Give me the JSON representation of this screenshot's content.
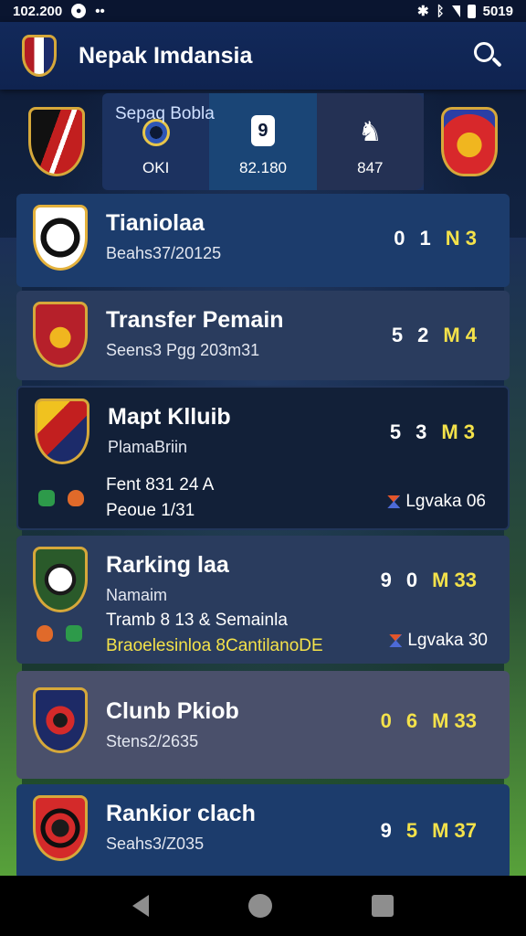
{
  "status_bar": {
    "time": "102.200",
    "clock": "5019"
  },
  "app_bar": {
    "title": "Nepak Imdansia",
    "search_icon": "search-icon"
  },
  "featured": {
    "label": "Sepaq Bobla",
    "stats": [
      {
        "icon": "ball-icon",
        "value": "OKI"
      },
      {
        "icon": "phone-icon",
        "glyph": "9",
        "value": "82.180"
      },
      {
        "icon": "chess-knight-icon",
        "glyph": "♞",
        "value": "847"
      }
    ]
  },
  "cards": [
    {
      "title": "Tianiolaa",
      "subtitle": "Beahs37/20125",
      "score": [
        "0",
        "1",
        "N 3"
      ]
    },
    {
      "title": "Transfer Pemain",
      "subtitle": "Seens3 Pgg 203m31",
      "score": [
        "5",
        "2",
        "M 4"
      ]
    },
    {
      "title": "Mapt Klluib",
      "subtitle": "PlamaBriin",
      "score": [
        "5",
        "3",
        "M 3"
      ],
      "extra": [
        "Fent 831 24 A",
        "Peoue 1/31"
      ],
      "tag": "Lgvaka 06"
    },
    {
      "title": "Rarking laa",
      "subtitle": "Namaim",
      "score": [
        "9",
        "0",
        "M 33"
      ],
      "extra": [
        "Tramb 8 13 &  Semainla",
        "Braoelesinloa 8CantilanoDE"
      ],
      "tag": "Lgvaka 30"
    },
    {
      "title": "Clunb Pkiob",
      "subtitle": "Stens2/2635",
      "score": [
        "0",
        "6",
        "M 33"
      ]
    },
    {
      "title": "Rankior clach",
      "subtitle": "Seahs3/Z035",
      "score": [
        "9",
        "5",
        "M 37"
      ]
    }
  ]
}
